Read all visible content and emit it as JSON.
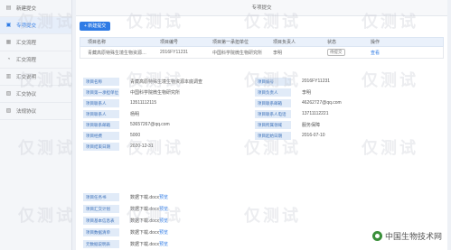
{
  "sidebar": {
    "items": [
      {
        "label": "新建提交",
        "icon": "document-icon"
      },
      {
        "label": "专项提交",
        "icon": "folder-icon",
        "active": true
      },
      {
        "label": "汇交流程",
        "icon": "flow-icon"
      },
      {
        "label": "汇交流程",
        "icon": "flow-icon"
      },
      {
        "label": "汇交说明",
        "icon": "info-icon"
      },
      {
        "label": "汇交协议",
        "icon": "agreement-icon"
      },
      {
        "label": "法规协议",
        "icon": "law-icon"
      }
    ]
  },
  "header": {
    "title": "专项提交"
  },
  "toolbar": {
    "add_label": "+ 新建提交"
  },
  "table": {
    "headers": [
      "项目名称",
      "项目编号",
      "项目第一承担单位",
      "项目负责人",
      "状态",
      "操作"
    ],
    "row": {
      "name": "青藏高原特殊生境生物资源…",
      "number": "2016FY11231",
      "unit": "中国科学院微生物研究所",
      "person": "李明",
      "status": "待提交",
      "action": "查看"
    }
  },
  "detail": {
    "rows": [
      {
        "l1": "项目名称",
        "v1": "青藏高原特殊生境生物资源本底调查",
        "l2": "项目编号",
        "v2": "2016FY11231"
      },
      {
        "l1": "项目第一承担单位",
        "v1": "中国科学院微生物研究所",
        "l2": "项目负责人",
        "v2": "李明"
      },
      {
        "l1": "项目联系人",
        "v1": "13511112115",
        "l2": "项目联系邮箱",
        "v2": "46262727@qq.com"
      },
      {
        "l1": "项目联系人",
        "v1": "杨明",
        "l2": "项目联系人电话",
        "v2": "13711112221"
      },
      {
        "l1": "项目联系邮箱",
        "v1": "53657267@qq.com",
        "l2": "项目所属领域",
        "v2": "服务保障"
      },
      {
        "l1": "项目经费",
        "v1": "5000",
        "l2": "项目起始日期",
        "v2": "2016-07-10"
      },
      {
        "l1": "项目结束日期",
        "v1": "2020-12-31",
        "l2": "",
        "v2": ""
      }
    ]
  },
  "docs": {
    "rows": [
      {
        "label": "项目任务书",
        "file": "数据下载.docx",
        "action": "预览"
      },
      {
        "label": "项目汇交计划",
        "file": "数据下载.docx",
        "action": "预览"
      },
      {
        "label": "项目基本信息表",
        "file": "数据下载.docx",
        "action": "预览"
      },
      {
        "label": "项目数据清单",
        "file": "数据下载.docx",
        "action": "预览"
      },
      {
        "label": "元数据说明表",
        "file": "数据下载.docx",
        "action": "预览"
      }
    ]
  },
  "watermark": {
    "text": "仅测试"
  },
  "brand": {
    "name": "中国生物技术网"
  }
}
